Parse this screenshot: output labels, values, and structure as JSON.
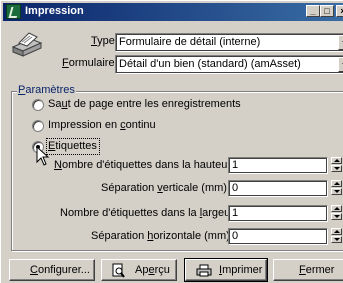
{
  "window": {
    "title": "Impression"
  },
  "titlebar": {
    "min": "_",
    "max": "□",
    "close": "×"
  },
  "form": {
    "type_label": {
      "pre": "",
      "key": "T",
      "post": "ype :"
    },
    "type_value": "Formulaire de détail (interne)",
    "formulaire_label": {
      "pre": "",
      "key": "F",
      "post": "ormulaire :"
    },
    "formulaire_value": "Détail d'un bien (standard) (amAsset)"
  },
  "params": {
    "title": {
      "pre": "",
      "key": "P",
      "post": "aramètres"
    },
    "opt1": {
      "pre": "Sa",
      "key": "u",
      "post": "t de page entre les enregistrements"
    },
    "opt2": {
      "pre": "Impression en ",
      "key": "c",
      "post": "ontinu"
    },
    "opt3": {
      "pre": "",
      "key": "E",
      "post": "tiquettes"
    },
    "selected": "opt3",
    "fields": {
      "nb_hauteur": {
        "pre": "",
        "key": "N",
        "post": "ombre d'étiquettes dans la hauteur :",
        "value": "1"
      },
      "sep_verticale": {
        "pre": "Séparation ",
        "key": "v",
        "post": "erticale (mm) :",
        "value": "0"
      },
      "nb_largeur": {
        "pre": "Nombre d'étiquettes dans la ",
        "key": "l",
        "post": "argeur :",
        "value": "1"
      },
      "sep_horizontale": {
        "pre": "Séparation ",
        "key": "h",
        "post": "orizontale (mm) :",
        "value": "0"
      }
    }
  },
  "buttons": {
    "configurer": {
      "pre": "",
      "key": "C",
      "post": "onfigurer..."
    },
    "apercu": {
      "pre": "Ap",
      "key": "e",
      "post": "rçu"
    },
    "imprimer": {
      "pre": "",
      "key": "I",
      "post": "mprimer"
    },
    "fermer": {
      "pre": "",
      "key": "F",
      "post": "ermer"
    }
  }
}
